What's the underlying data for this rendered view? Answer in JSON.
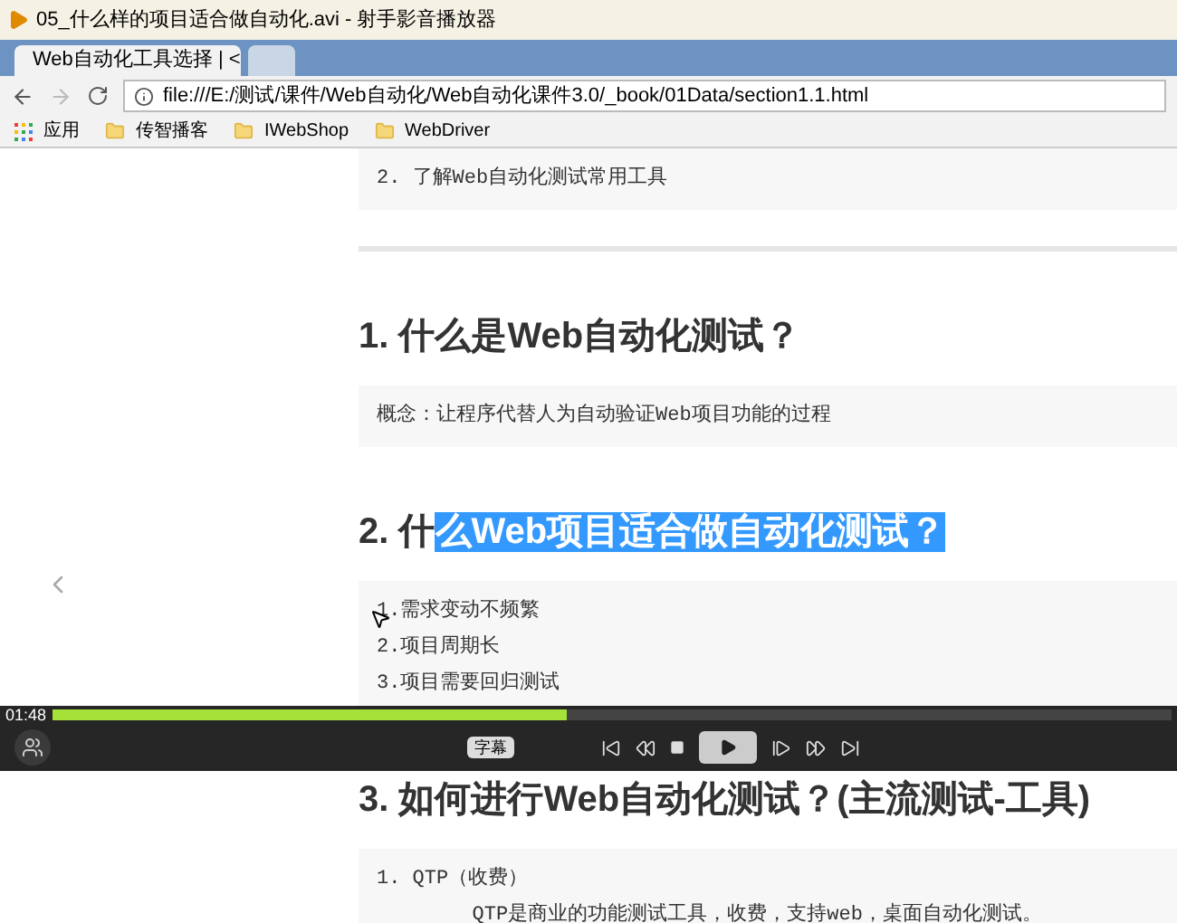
{
  "window": {
    "title": "05_什么样的项目适合做自动化.avi - 射手影音播放器"
  },
  "tabs": [
    {
      "label": "Web自动化工具选择 | <",
      "selected": true
    },
    {
      "selected": false
    }
  ],
  "address_bar": {
    "url": "file:///E:/测试/课件/Web自动化/Web自动化课件3.0/_book/01Data/section1.1.html"
  },
  "bookmarks": [
    {
      "kind": "apps",
      "label": "应用"
    },
    {
      "kind": "folder",
      "label": "传智播客"
    },
    {
      "kind": "folder",
      "label": "IWebShop"
    },
    {
      "kind": "folder",
      "label": "WebDriver"
    }
  ],
  "content": [
    {
      "kind": "box",
      "lines": [
        "2. 了解Web自动化测试常用工具"
      ]
    },
    {
      "kind": "rule"
    },
    {
      "kind": "heading",
      "parts": [
        {
          "text": "1. 什么是Web自动化测试？",
          "selected": false
        }
      ]
    },
    {
      "kind": "box",
      "lines": [
        "概念：让程序代替人为自动验证Web项目功能的过程"
      ]
    },
    {
      "kind": "heading",
      "parts": [
        {
          "text": "2. 什",
          "selected": false
        },
        {
          "text": "么Web项目适合做自动化测试？",
          "selected": true
        }
      ]
    },
    {
      "kind": "box",
      "lines": [
        "1.需求变动不频繁",
        "2.项目周期长",
        "3.项目需要回归测试"
      ]
    },
    {
      "kind": "heading",
      "parts": [
        {
          "text": "3. 如何进行Web自动化测试？(主流测试-工具)",
          "selected": false
        }
      ]
    },
    {
      "kind": "box",
      "lines": [
        "1. QTP（收费）",
        "        QTP是商业的功能测试工具，收费，支持web，桌面自动化测试。"
      ]
    }
  ],
  "player": {
    "time": "01:48",
    "level": 0.46,
    "subtitle_button": "字幕"
  }
}
